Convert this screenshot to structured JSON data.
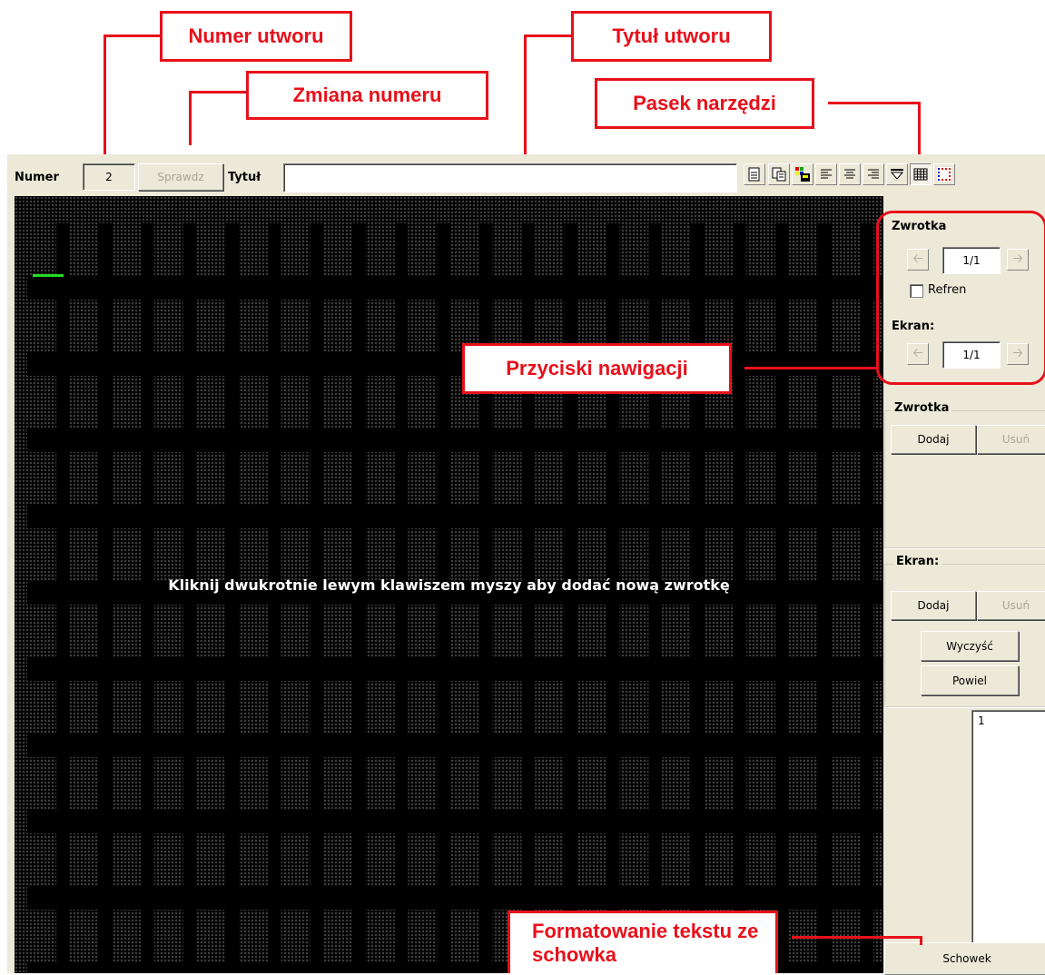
{
  "callouts": {
    "numer_utworu": "Numer utworu",
    "zmiana_numeru": "Zmiana numeru",
    "tytul_utworu": "Tytuł utworu",
    "pasek_narzedzi": "Pasek narzędzi",
    "przyciski_nawigacji": "Przyciski nawigacji",
    "formatowanie": "Formatowanie tekstu ze schowka"
  },
  "toolbar": {
    "numer_label": "Numer",
    "numer_value": "2",
    "sprawdz_label": "Sprawdz",
    "tytul_label": "Tytuł",
    "tytul_value": "",
    "buttons": [
      "new-doc-icon",
      "copy-icon",
      "color-save-icon",
      "align-left-icon",
      "align-center-icon",
      "align-right-icon",
      "valign-icon",
      "grid-icon",
      "dots-color-icon"
    ]
  },
  "screen": {
    "hint": "Kliknij dwukrotnie lewym klawiszem myszy aby dodać nową zwrotkę",
    "background": "#000000",
    "cursor_color": "#22dd22"
  },
  "nav": {
    "zwrotka_label": "Zwrotka",
    "zwrotka_value": "1/1",
    "refren_label": "Refren",
    "ekran_label": "Ekran:",
    "ekran_value": "1/1"
  },
  "zwrotka_group": {
    "title": "Zwrotka",
    "dodaj": "Dodaj",
    "usun": "Usuń"
  },
  "ekran_group": {
    "title": "Ekran:",
    "dodaj": "Dodaj",
    "usun": "Usuń",
    "wyczysc": "Wyczyść",
    "powiel": "Powiel"
  },
  "list": {
    "value": "1"
  },
  "schowek_label": "Schowek",
  "colors": {
    "callout": "#e8101a",
    "window": "#ece9d8"
  }
}
